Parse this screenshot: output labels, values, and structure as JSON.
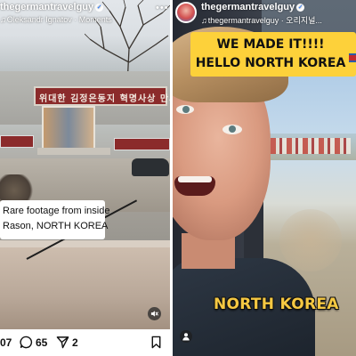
{
  "left_post": {
    "username": "thegermantravelguy",
    "subtitle": "Oleksandr Ignatov · Moments",
    "billboard_text": "위대한 김정은동지 혁명사상 만세!",
    "caption_lines": [
      "Rare footage from inside",
      "Rason, NORTH KOREA"
    ],
    "actions": {
      "likes_partial": "07",
      "comments_count": "65",
      "shares_count": "2"
    }
  },
  "right_post": {
    "username": "thegermantravelguy",
    "subtitle": "thegermantravelguy · 오리지널...",
    "banner_lines": [
      "WE MADE IT!!!!",
      "HELLO NORTH KOREA"
    ],
    "overlay_text": "NORTH KOREA"
  },
  "colors": {
    "banner_yellow": "#fdd13a",
    "overlay_gold": "#f5c842",
    "verified_blue": "#3b82f6"
  },
  "icons": {
    "left_header": [
      "verified-badge-icon",
      "more-options-icon"
    ],
    "left_actions": [
      "comment-icon",
      "share-icon",
      "bookmark-icon"
    ],
    "left_media": [
      "mute-icon"
    ],
    "right_header": [
      "avatar",
      "verified-badge-icon",
      "music-note-icon"
    ],
    "right_media": [
      "user-tag-icon"
    ]
  }
}
